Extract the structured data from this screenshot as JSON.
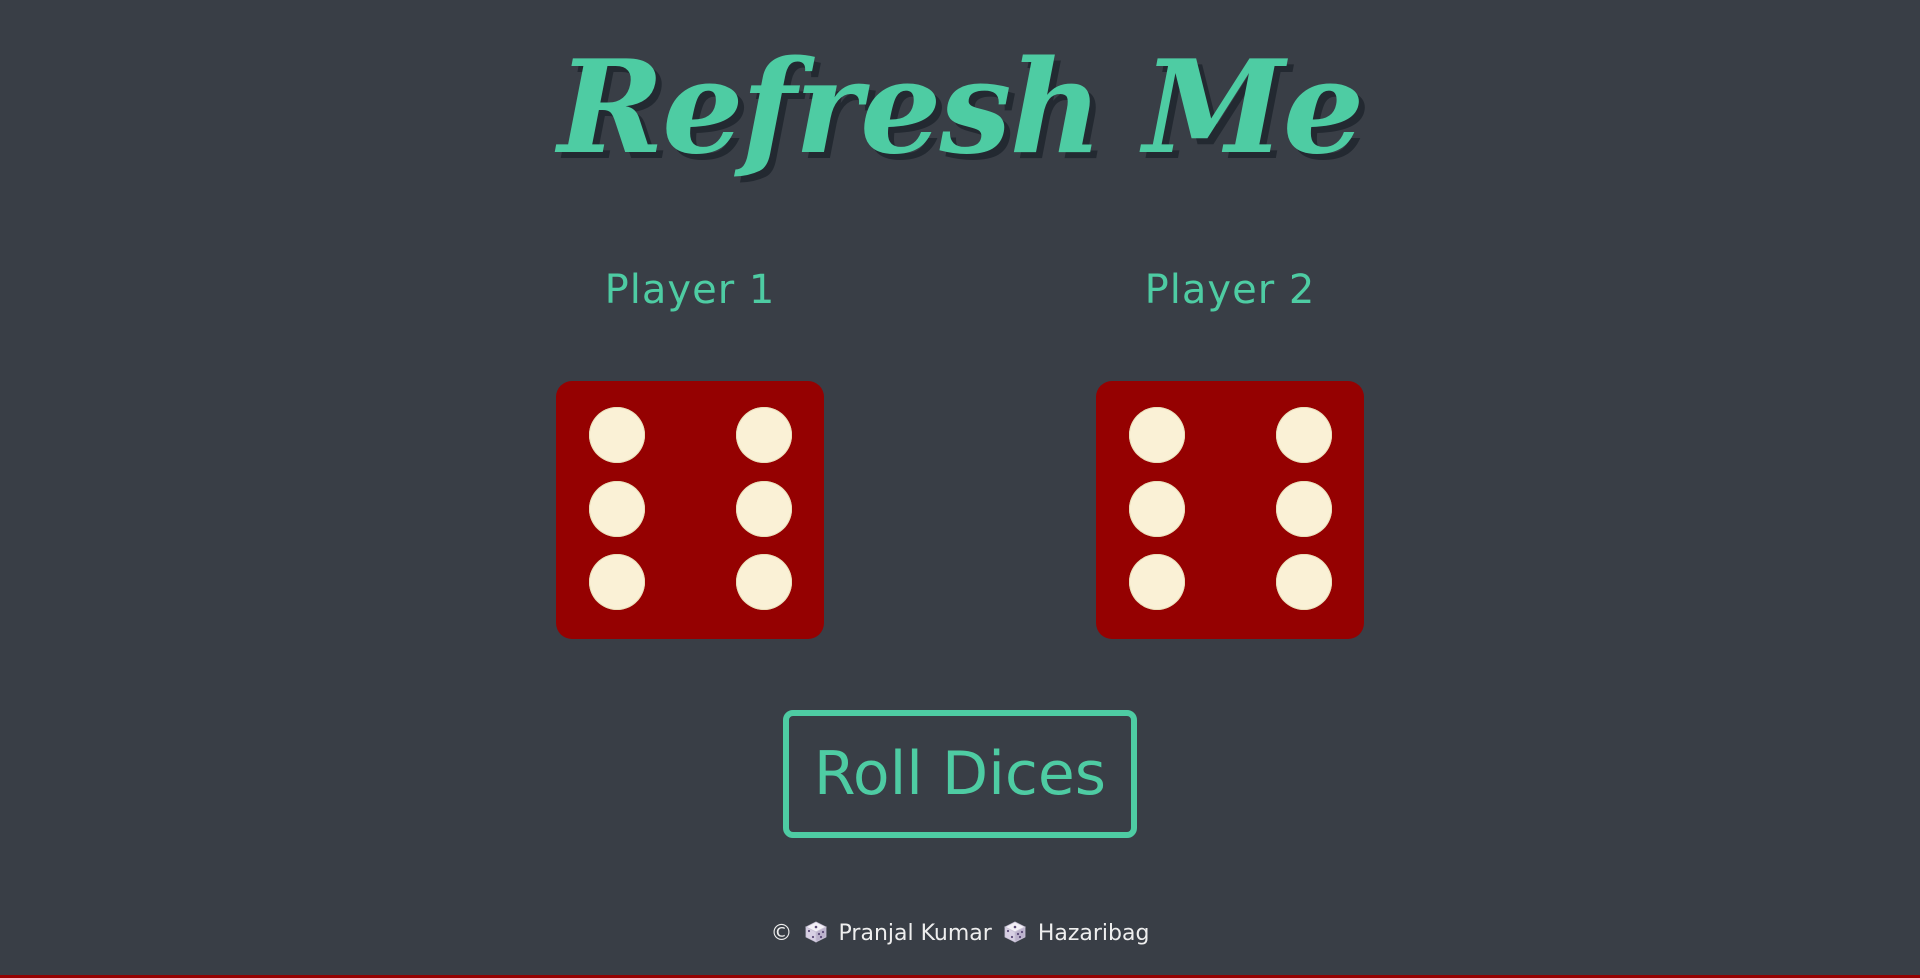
{
  "header": {
    "title": "Refresh Me"
  },
  "players": [
    {
      "label": "Player 1",
      "die_value": 6
    },
    {
      "label": "Player 2",
      "die_value": 6
    }
  ],
  "controls": {
    "roll_label": "Roll Dices"
  },
  "footer": {
    "copyright_symbol": "©",
    "author": "Pranjal Kumar",
    "location": "Hazaribag",
    "icon": "dice-icon"
  },
  "colors": {
    "background": "#393E46",
    "accent": "#4ECCA3",
    "die_face": "#950101",
    "pip": "#FAF1D6",
    "footer_text": "#EEEEEE"
  }
}
